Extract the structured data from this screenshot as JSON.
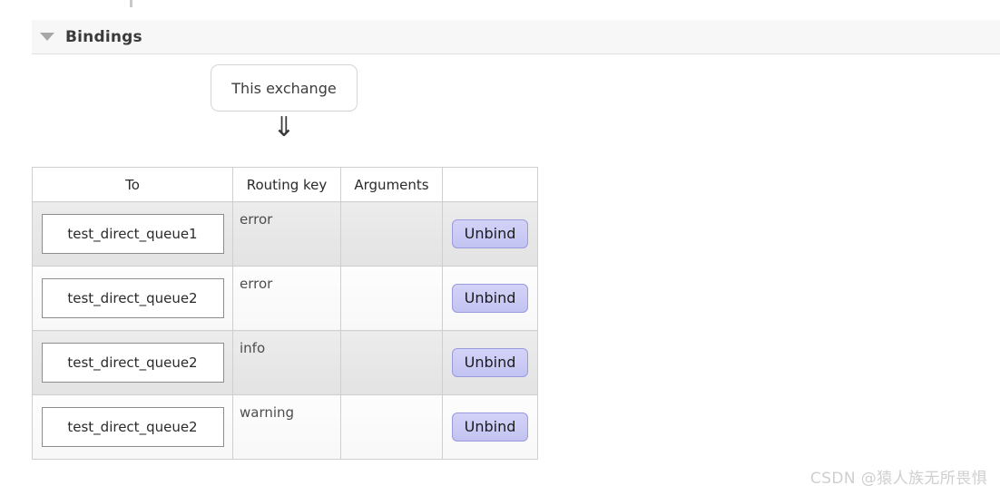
{
  "section": {
    "title": "Bindings",
    "collapse_icon": "triangle-down-icon",
    "expanded": true
  },
  "graph": {
    "source_node_label": "This exchange",
    "arrow_glyph": "⇓",
    "arrow_icon": "double-down-arrow-icon"
  },
  "table": {
    "columns": [
      "To",
      "Routing key",
      "Arguments",
      ""
    ],
    "action_label": "Unbind",
    "rows": [
      {
        "to": "test_direct_queue1",
        "routing_key": "error",
        "arguments": "",
        "action": "Unbind"
      },
      {
        "to": "test_direct_queue2",
        "routing_key": "error",
        "arguments": "",
        "action": "Unbind"
      },
      {
        "to": "test_direct_queue2",
        "routing_key": "info",
        "arguments": "",
        "action": "Unbind"
      },
      {
        "to": "test_direct_queue2",
        "routing_key": "warning",
        "arguments": "",
        "action": "Unbind"
      }
    ]
  },
  "watermark": {
    "text": "CSDN @猿人族无所畏惧"
  },
  "colors": {
    "header_bg": "#f7f7f7",
    "button_bg": "#c9c9f4",
    "button_border": "#9a9ade",
    "row_odd_bg": "#e8e8e8",
    "row_even_bg": "#fbfbfb",
    "border": "#cfcfcf",
    "text": "#333333",
    "watermark": "#cfcfcf"
  }
}
